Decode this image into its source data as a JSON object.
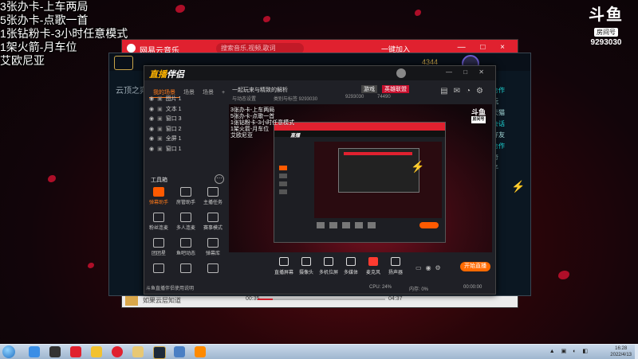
{
  "overlay": {
    "lines": [
      "3张办卡-上车两局",
      "5张办卡-点歌一首",
      "1张钻粉卡-3小时任意模式",
      "1架火箭-月车位",
      "艾欧尼亚"
    ]
  },
  "douyu": {
    "mark": "斗鱼",
    "sub": "房间号",
    "room": "9293030"
  },
  "music": {
    "title": "网易云音乐",
    "search_placeholder": "搜索音乐,视频,歌词",
    "user": "一键加入",
    "controls": "— □ ×",
    "song": "如果云层知道",
    "time_current": "00:35",
    "time_total": "04:37",
    "progress": 0.12
  },
  "lol": {
    "rp": "4344",
    "side_items": [
      "云顶之弈"
    ],
    "right_items": [
      "合作",
      "玩",
      "天猫",
      "会话",
      "好友",
      "合作",
      "奇",
      "子"
    ],
    "bolt": "⚡"
  },
  "stream": {
    "logo_prefix": "直播",
    "logo_suffix": "伴侣",
    "tabs": [
      "我的场景",
      "场景",
      "场景"
    ],
    "sources": [
      {
        "name": "图片 1"
      },
      {
        "name": "文本 1"
      },
      {
        "name": "窗口 3"
      },
      {
        "name": "窗口 2"
      },
      {
        "name": "全屏 1"
      },
      {
        "name": "窗口 1"
      }
    ],
    "title": "一起玩来与精致的解析",
    "tag1": "游戏",
    "tag2": "英雄联盟",
    "info": [
      "与动态设置",
      "类别与标签 9293030",
      "9293030",
      "74490"
    ],
    "tools_label": "工具箱",
    "tools": [
      {
        "label": "弹幕助手",
        "hot": true
      },
      {
        "label": "房管助手",
        "hot": false
      },
      {
        "label": "主播任务",
        "hot": false
      },
      {
        "label": "粉丝连麦",
        "hot": false
      },
      {
        "label": "多人连麦",
        "hot": false
      },
      {
        "label": "赛事模式",
        "hot": false
      },
      {
        "label": "团团星",
        "hot": false
      },
      {
        "label": "鱼吧动态",
        "hot": false
      },
      {
        "label": "弹幕库",
        "hot": false
      },
      {
        "label": "",
        "hot": false
      },
      {
        "label": "",
        "hot": false
      },
      {
        "label": "",
        "hot": false
      }
    ],
    "notice": "斗鱼直播伴侣使用说明",
    "toolbar": [
      {
        "label": "直播屏幕",
        "red": false
      },
      {
        "label": "摄像头",
        "red": false
      },
      {
        "label": "多机位屏",
        "red": false
      },
      {
        "label": "多媒体",
        "red": false
      },
      {
        "label": "麦克风",
        "red": true
      },
      {
        "label": "扬声器",
        "red": false
      }
    ],
    "go_live": "开始直播",
    "status": [
      "CPU: 24%",
      "内存: 0%",
      "00:00:00"
    ]
  },
  "preview": {
    "lines": [
      "3张办卡-上车两局",
      "5张办卡-点歌一首",
      "1张钻粉卡-3小时任意模式",
      "1架火箭-月车位",
      "艾欧尼亚"
    ],
    "logo": "斗鱼",
    "logo_sub": "房间号"
  },
  "taskbar": {
    "tray": "▲ ▣ ◐ ◧",
    "time": "16:28",
    "date": "2022/4/13"
  }
}
